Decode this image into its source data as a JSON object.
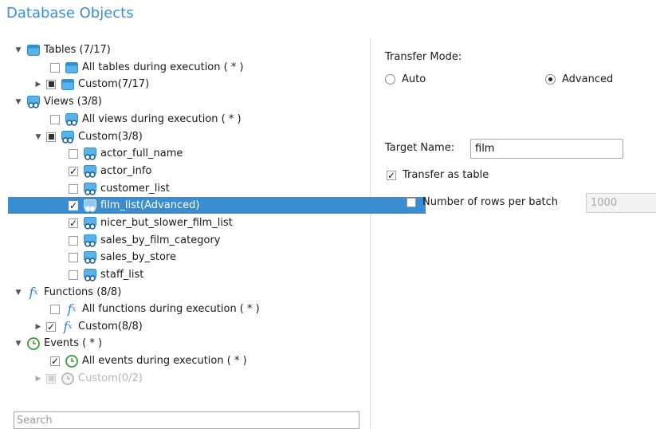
{
  "header": {
    "title": "Database Objects"
  },
  "tree": {
    "tables": {
      "label": "Tables (7/17)",
      "all": "All tables during execution ( * )",
      "custom": "Custom(7/17)"
    },
    "views": {
      "label": "Views (3/8)",
      "all": "All views during execution ( * )",
      "custom": "Custom(3/8)",
      "items": [
        {
          "label": "actor_full_name",
          "checked": false
        },
        {
          "label": "actor_info",
          "checked": true
        },
        {
          "label": "customer_list",
          "checked": false
        },
        {
          "label": "film_list(Advanced)",
          "checked": true,
          "selected": true
        },
        {
          "label": "nicer_but_slower_film_list",
          "checked": true
        },
        {
          "label": "sales_by_film_category",
          "checked": false
        },
        {
          "label": "sales_by_store",
          "checked": false
        },
        {
          "label": "staff_list",
          "checked": false
        }
      ]
    },
    "functions": {
      "label": "Functions (8/8)",
      "all": "All functions during execution ( * )",
      "custom": "Custom(8/8)"
    },
    "events": {
      "label": "Events ( * )",
      "all": "All events during execution ( * )",
      "custom": "Custom(0/2)"
    }
  },
  "search": {
    "placeholder": "Search",
    "value": ""
  },
  "options": {
    "transfer_mode_label": "Transfer Mode:",
    "mode_auto": "Auto",
    "mode_advanced": "Advanced",
    "selected_mode": "Advanced",
    "target_name_label": "Target Name:",
    "target_name_value": "film",
    "transfer_as_table": "Transfer as table",
    "transfer_as_table_checked": true,
    "rows_per_batch_label": "Number of rows per batch",
    "rows_per_batch_checked": false,
    "rows_per_batch_value": "1000"
  },
  "colors": {
    "accent": "#3a8dd1",
    "title": "#3a8fd6",
    "functions_icon": "#2f7fd0",
    "events_icon": "#3c9a3c"
  }
}
